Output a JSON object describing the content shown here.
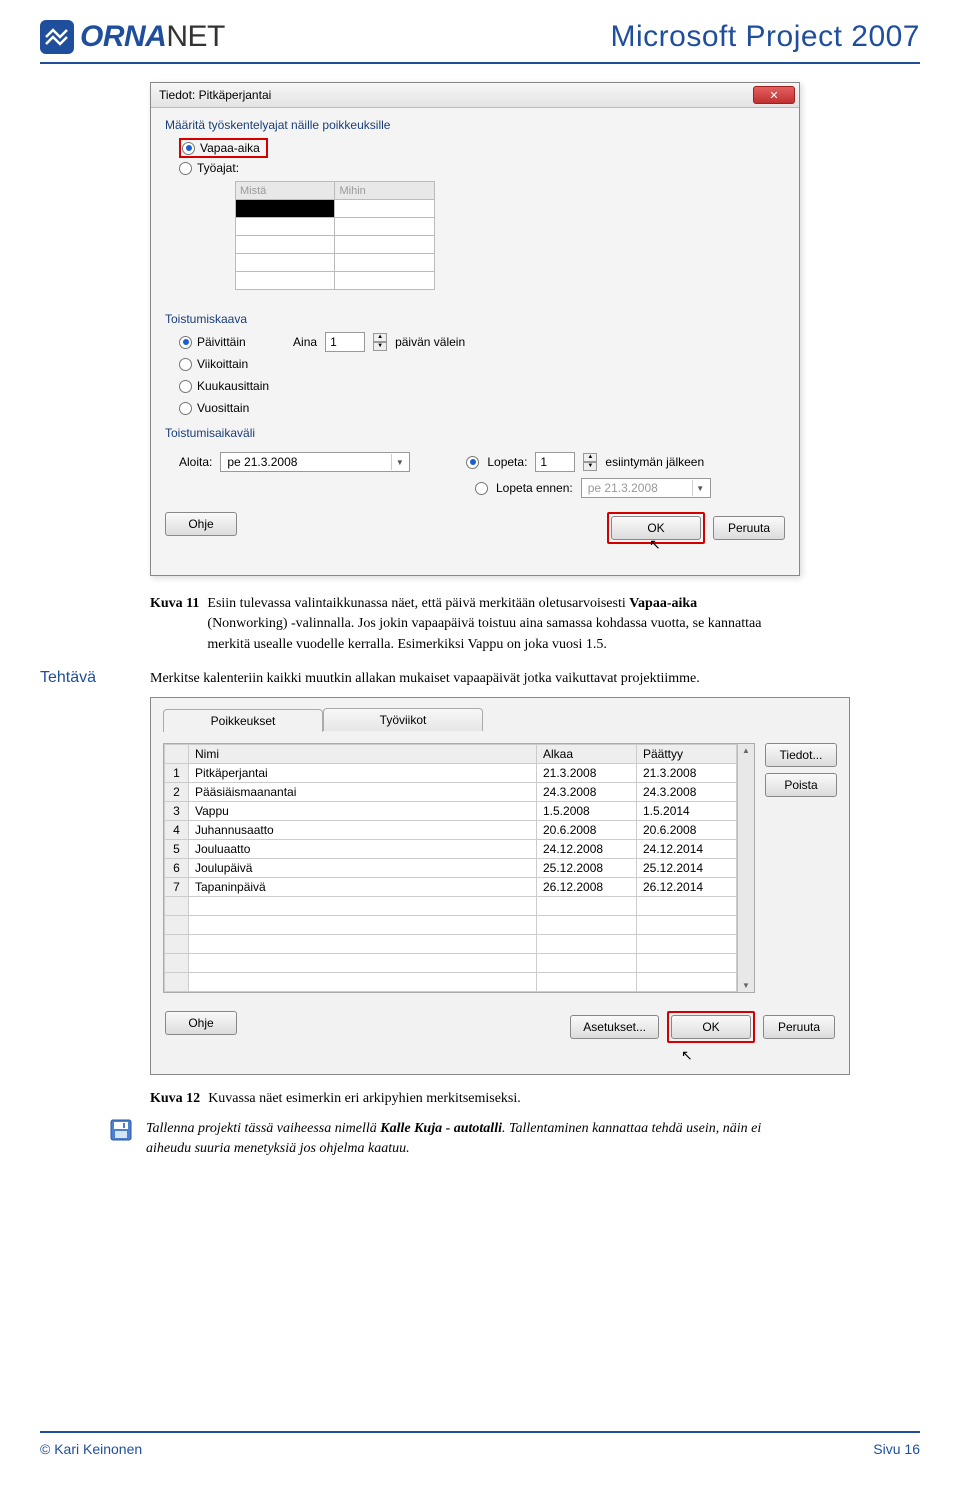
{
  "header": {
    "logo_bold": "ORNA",
    "logo_light": "NET",
    "doc_title": "Microsoft Project 2007"
  },
  "dialog1": {
    "title": "Tiedot: Pitkäperjantai",
    "section1_label": "Määritä työskentelyajat näille poikkeuksille",
    "radio_vapaa": "Vapaa-aika",
    "radio_tyoajat": "Työajat:",
    "col_mista": "Mistä",
    "col_mihin": "Mihin",
    "section2_label": "Toistumiskaava",
    "recur_options": {
      "paivittain": "Päivittäin",
      "viikoittain": "Viikoittain",
      "kuukausittain": "Kuukausittain",
      "vuosittain": "Vuosittain"
    },
    "aina": "Aina",
    "aina_val": "1",
    "paivan_valein": "päivän välein",
    "section3_label": "Toistumisaikaväli",
    "aloita": "Aloita:",
    "aloita_val": "pe 21.3.2008",
    "lopeta": "Lopeta:",
    "lopeta_val": "1",
    "esiintyman": "esiintymän jälkeen",
    "lopeta_ennen": "Lopeta ennen:",
    "lopeta_ennen_val": "pe 21.3.2008",
    "ohje": "Ohje",
    "ok": "OK",
    "peruuta": "Peruuta"
  },
  "caption11": {
    "label": "Kuva 11",
    "text_before": "Esiin tulevassa valintaikkunassa näet, että päivä merkitään oletusarvoisesti ",
    "bold": "Vapaa-aika",
    "text_after": " (Nonworking) -valinnalla. Jos jokin vapaapäivä toistuu aina samassa kohdassa vuotta, se kannattaa merkitä usealle vuodelle kerralla. Esimerkiksi Vappu on joka vuosi 1.5."
  },
  "tehtava": {
    "label": "Tehtävä",
    "text": "Merkitse kalenteriin kaikki muutkin allakan mukaiset vapaapäivät jotka vaikuttavat projektiimme."
  },
  "dialog2": {
    "tab1": "Poikkeukset",
    "tab2": "Työviikot",
    "col_nimi": "Nimi",
    "col_alkaa": "Alkaa",
    "col_paattyy": "Päättyy",
    "rows": [
      {
        "n": "1",
        "nimi": "Pitkäperjantai",
        "alkaa": "21.3.2008",
        "paattyy": "21.3.2008"
      },
      {
        "n": "2",
        "nimi": "Pääsiäismaanantai",
        "alkaa": "24.3.2008",
        "paattyy": "24.3.2008"
      },
      {
        "n": "3",
        "nimi": "Vappu",
        "alkaa": "1.5.2008",
        "paattyy": "1.5.2014"
      },
      {
        "n": "4",
        "nimi": "Juhannusaatto",
        "alkaa": "20.6.2008",
        "paattyy": "20.6.2008"
      },
      {
        "n": "5",
        "nimi": "Jouluaatto",
        "alkaa": "24.12.2008",
        "paattyy": "24.12.2014"
      },
      {
        "n": "6",
        "nimi": "Joulupäivä",
        "alkaa": "25.12.2008",
        "paattyy": "25.12.2014"
      },
      {
        "n": "7",
        "nimi": "Tapaninpäivä",
        "alkaa": "26.12.2008",
        "paattyy": "26.12.2014"
      }
    ],
    "tiedot": "Tiedot...",
    "poista": "Poista",
    "ohje": "Ohje",
    "asetukset": "Asetukset...",
    "ok": "OK",
    "peruuta": "Peruuta"
  },
  "caption12": {
    "label": "Kuva 12",
    "text": "Kuvassa näet esimerkin eri arkipyhien merkitsemiseksi."
  },
  "save": {
    "text_before": "Tallenna projekti tässä vaiheessa nimellä ",
    "bold": "Kalle Kuja - autotalli",
    "text_after": ". Tallentaminen kannattaa tehdä usein, näin ei aiheudu suuria menetyksiä jos ohjelma kaatuu."
  },
  "footer": {
    "left": "© Kari Keinonen",
    "right": "Sivu 16"
  }
}
